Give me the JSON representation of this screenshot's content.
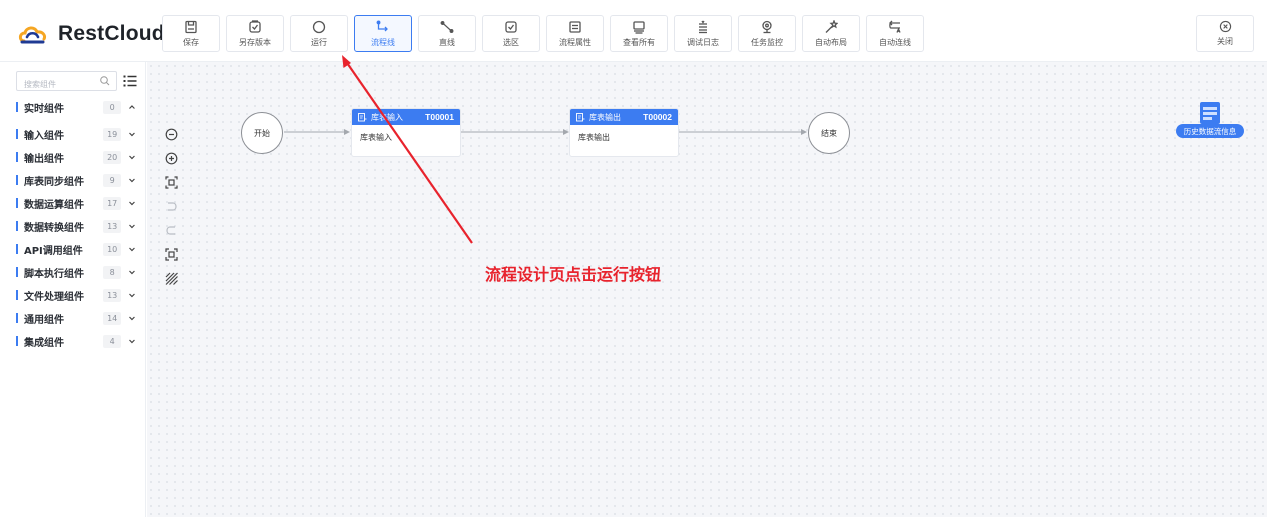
{
  "app": {
    "brand_name": "RestCloud"
  },
  "toolbar": {
    "tools": [
      {
        "label": "保存",
        "icon": "save-icon"
      },
      {
        "label": "另存版本",
        "icon": "save-version-icon"
      },
      {
        "label": "运行",
        "icon": "run-circle-icon"
      },
      {
        "label": "流程线",
        "icon": "flow-line-icon",
        "active": true
      },
      {
        "label": "直线",
        "icon": "straight-line-icon"
      },
      {
        "label": "选区",
        "icon": "selection-icon"
      },
      {
        "label": "流程属性",
        "icon": "flow-properties-icon"
      },
      {
        "label": "查看所有",
        "icon": "view-all-icon"
      },
      {
        "label": "调试日志",
        "icon": "debug-log-icon"
      },
      {
        "label": "任务监控",
        "icon": "task-monitor-icon"
      },
      {
        "label": "自动布局",
        "icon": "auto-layout-icon"
      },
      {
        "label": "自动连线",
        "icon": "auto-connect-icon"
      }
    ],
    "close_label": "关闭"
  },
  "sidebar": {
    "search_placeholder": "搜索组件",
    "categories": [
      {
        "name": "实时组件",
        "count": "0",
        "expanded": true
      },
      {
        "name": "输入组件",
        "count": "19"
      },
      {
        "name": "输出组件",
        "count": "20"
      },
      {
        "name": "库表同步组件",
        "count": "9"
      },
      {
        "name": "数据运算组件",
        "count": "17"
      },
      {
        "name": "数据转换组件",
        "count": "13"
      },
      {
        "name": "API调用组件",
        "count": "10"
      },
      {
        "name": "脚本执行组件",
        "count": "8"
      },
      {
        "name": "文件处理组件",
        "count": "13"
      },
      {
        "name": "通用组件",
        "count": "14"
      },
      {
        "name": "集成组件",
        "count": "4"
      }
    ]
  },
  "canvas": {
    "start_label": "开始",
    "end_label": "结束",
    "nodes": [
      {
        "title": "库表输入",
        "code": "T00001",
        "body": "库表输入"
      },
      {
        "title": "库表输出",
        "code": "T00002",
        "body": "库表输出"
      }
    ],
    "history_label": "历史数据流信息",
    "annotation": "流程设计页点击运行按钮"
  },
  "colors": {
    "accent": "#3c7cf1",
    "annotation": "#e8232d",
    "brand_orange": "#f5a623",
    "brand_blue": "#1f3a93"
  }
}
